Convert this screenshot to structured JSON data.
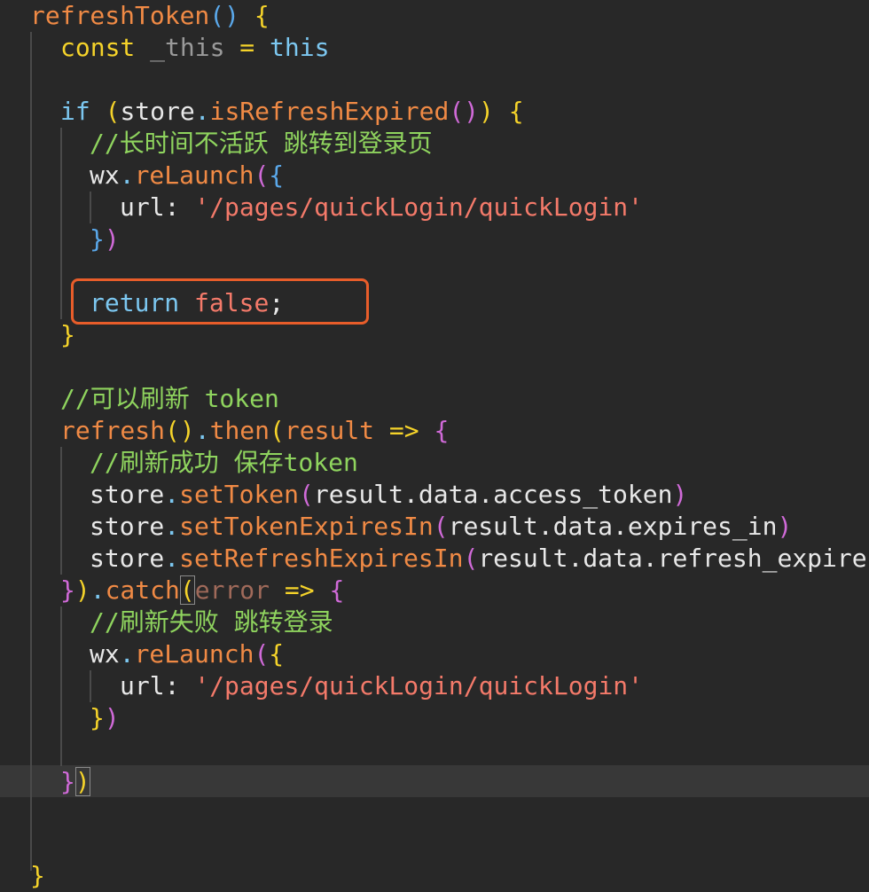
{
  "editor": {
    "lines": {
      "l1": {
        "name": "refreshToken",
        "p1": "(",
        "p2": ")",
        "brace": " {"
      },
      "l2": {
        "kw": "const",
        "var": " _this",
        "op": " = ",
        "val": "this"
      },
      "l4": {
        "kw": "if",
        "p1": " (",
        "obj": "store",
        "dot": ".",
        "fn": "isRefreshExpired",
        "c1": "(",
        "c2": ")",
        "p2": ")",
        "brace": " {"
      },
      "l5": {
        "comment": "//长时间不活跃 跳转到登录页"
      },
      "l6": {
        "obj": "wx",
        "dot": ".",
        "fn": "reLaunch",
        "p": "(",
        "brace": "{"
      },
      "l7": {
        "key": "url: ",
        "str": "'/pages/quickLogin/quickLogin'"
      },
      "l8": {
        "brace": "}",
        "p": ")"
      },
      "l10": {
        "kw": "return",
        "sp": " ",
        "val": "false",
        "semi": ";"
      },
      "l11": {
        "brace": "}"
      },
      "l13": {
        "comment": "//可以刷新 token"
      },
      "l14": {
        "fn": "refresh",
        "p1": "(",
        "p2": ")",
        "dot": ".",
        "fn2": "then",
        "p3": "(",
        "arg": "result",
        "arrow": " => ",
        "brace": "{"
      },
      "l15": {
        "comment": "//刷新成功 保存token"
      },
      "l16": {
        "obj": "store",
        "dot": ".",
        "fn": "setToken",
        "p1": "(",
        "arg": "result.data.access_token",
        "p2": ")"
      },
      "l17": {
        "obj": "store",
        "dot": ".",
        "fn": "setTokenExpiresIn",
        "p1": "(",
        "arg": "result.data.expires_in",
        "p2": ")"
      },
      "l18": {
        "obj": "store",
        "dot": ".",
        "fn": "setRefreshExpiresIn",
        "p1": "(",
        "arg": "result.data.refresh_expire"
      },
      "l19": {
        "brace": "}",
        "p": ")",
        "dot": ".",
        "fn": "catch",
        "p2": "(",
        "arg": "error",
        "arrow": " => ",
        "brace2": "{"
      },
      "l20": {
        "comment": "//刷新失败 跳转登录"
      },
      "l21": {
        "obj": "wx",
        "dot": ".",
        "fn": "reLaunch",
        "p": "(",
        "brace": "{"
      },
      "l22": {
        "key": "url: ",
        "str": "'/pages/quickLogin/quickLogin'"
      },
      "l23": {
        "brace": "}",
        "p": ")"
      },
      "l25": {
        "brace": "}",
        "p": ")"
      },
      "l27": {
        "brace": "}"
      }
    }
  }
}
